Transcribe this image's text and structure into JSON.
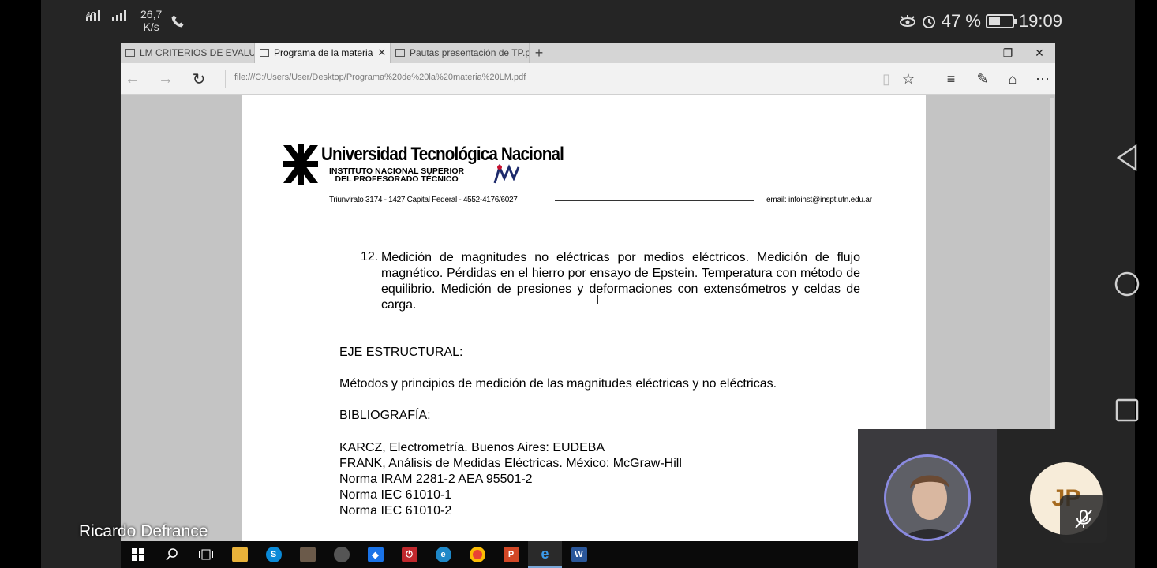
{
  "status_bar": {
    "network": "4G",
    "speed_value": "26,7",
    "speed_unit": "K/s",
    "battery_percent": "47 %",
    "time": "19:09"
  },
  "browser": {
    "tabs": [
      {
        "label": "LM CRITERIOS DE EVALUACI",
        "active": false
      },
      {
        "label": "Programa de la materia",
        "active": true,
        "close": "✕"
      },
      {
        "label": "Pautas presentación de TP.p",
        "active": false
      }
    ],
    "new_tab": "+",
    "url": "file:///C:/Users/User/Desktop/Programa%20de%20la%20materia%20LM.pdf"
  },
  "document": {
    "university": "Universidad Tecnológica Nacional",
    "institute_line1": "INSTITUTO NACIONAL SUPERIOR",
    "institute_line2": "DEL PROFESORADO TÉCNICO",
    "address": "Triunvirato 3174 - 1427 Capital Federal - 4552-4176/6027",
    "email": "email: infoinst@inspt.utn.edu.ar",
    "item_number": "12.",
    "item_text": "Medición de magnitudes no eléctricas por medios eléctricos. Medición de flujo magnético. Pérdidas en el hierro por ensayo de Epstein. Temperatura con método de equilibrio. Medición de presiones y deformaciones con extensómetros y celdas de carga.",
    "eje_heading": "EJE ESTRUCTURAL:",
    "eje_text": "Métodos y principios de medición de las magnitudes eléctricas y no eléctricas.",
    "bib_heading": "BIBLIOGRAFÍA:",
    "bibliography": [
      "KARCZ, Electrometría. Buenos Aires: EUDEBA",
      "FRANK, Análisis de Medidas Eléctricas. México: McGraw-Hill",
      "Norma IRAM 2281-2 AEA 95501-2",
      "Norma IEC 61010-1",
      "Norma IEC 61010-2"
    ]
  },
  "meeting": {
    "presenter_name": "Ricardo Defrance",
    "participant_initials": "JP"
  }
}
